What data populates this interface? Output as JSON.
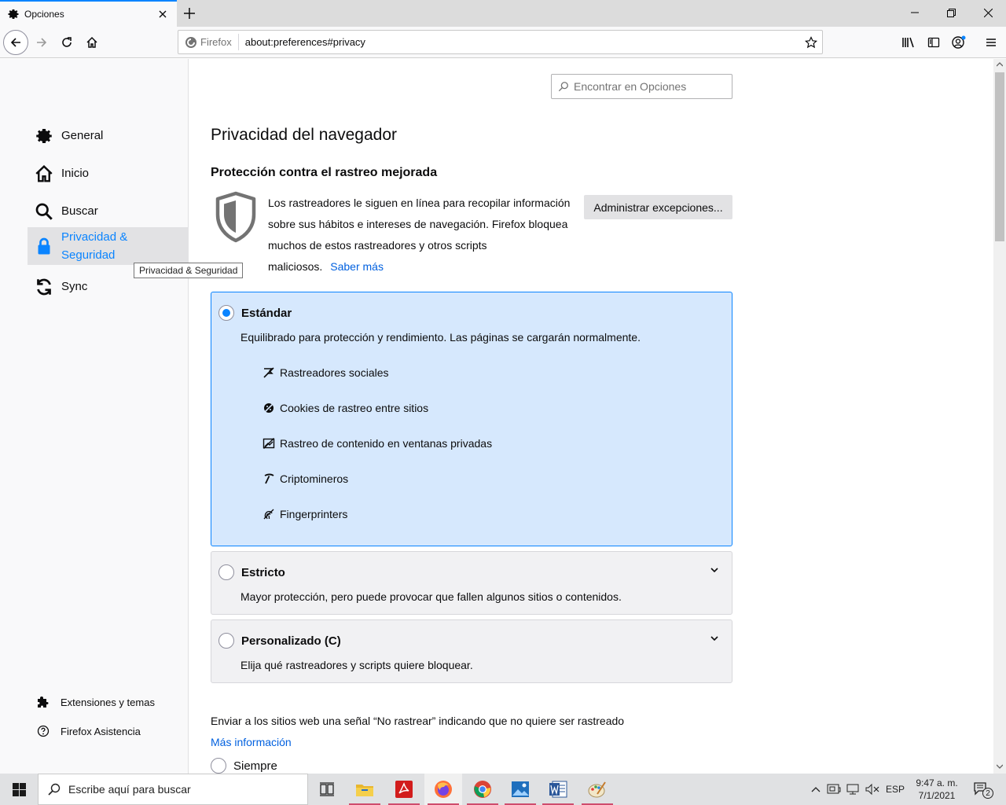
{
  "tab": {
    "title": "Opciones",
    "icon": "gear-icon"
  },
  "urlbar": {
    "identity_label": "Firefox",
    "url": "about:preferences#privacy"
  },
  "sidebar": {
    "categories": [
      {
        "label": "General",
        "icon": "gear-icon"
      },
      {
        "label": "Inicio",
        "icon": "home-icon"
      },
      {
        "label": "Buscar",
        "icon": "search-icon"
      },
      {
        "label": "Privacidad &",
        "label2": "Seguridad",
        "icon": "lock-icon",
        "selected": true
      },
      {
        "label": "Sync",
        "icon": "sync-icon"
      }
    ],
    "footer": [
      {
        "label": "Extensiones y temas",
        "icon": "puzzle-icon"
      },
      {
        "label": "Firefox Asistencia",
        "icon": "help-icon"
      }
    ],
    "tooltip": "Privacidad & Seguridad"
  },
  "main": {
    "search_placeholder": "Encontrar en Opciones",
    "section_title": "Privacidad del navegador",
    "etp_heading": "Protección contra el rastreo mejorada",
    "etp_description": "Los rastreadores le siguen en línea para recopilar información sobre sus hábitos e intereses de navegación. Firefox bloquea muchos de estos rastreadores y otros scripts maliciosos.",
    "etp_learn_more": "Saber más",
    "exceptions_button": "Administrar excepciones...",
    "options": [
      {
        "title": "Estándar",
        "description": "Equilibrado para protección y rendimiento. Las páginas se cargarán normalmente.",
        "selected": true,
        "features": [
          {
            "label": "Rastreadores sociales",
            "icon": "social-tracker-icon"
          },
          {
            "label": "Cookies de rastreo entre sitios",
            "icon": "cookie-icon"
          },
          {
            "label": "Rastreo de contenido en ventanas privadas",
            "icon": "content-tracker-icon"
          },
          {
            "label": "Criptomineros",
            "icon": "cryptominer-icon"
          },
          {
            "label": "Fingerprinters",
            "icon": "fingerprinter-icon"
          }
        ]
      },
      {
        "title": "Estricto",
        "description": "Mayor protección, pero puede provocar que fallen algunos sitios o contenidos.",
        "selected": false
      },
      {
        "title": "Personalizado (C)",
        "description": "Elija qué rastreadores y scripts quiere bloquear.",
        "selected": false
      }
    ],
    "dnt_text": "Enviar a los sitios web una señal “No rastrear” indicando que no quiere ser rastreado",
    "dnt_link": "Más información",
    "dnt_always": "Siempre"
  },
  "taskbar": {
    "search_placeholder": "Escribe aquí para buscar",
    "language": "ESP",
    "time": "9:47 a. m.",
    "date": "7/1/2021",
    "notifications": "2"
  },
  "colors": {
    "accent": "#0a84ff",
    "link": "#0060df",
    "selected_option_bg": "#d6e8fd"
  }
}
